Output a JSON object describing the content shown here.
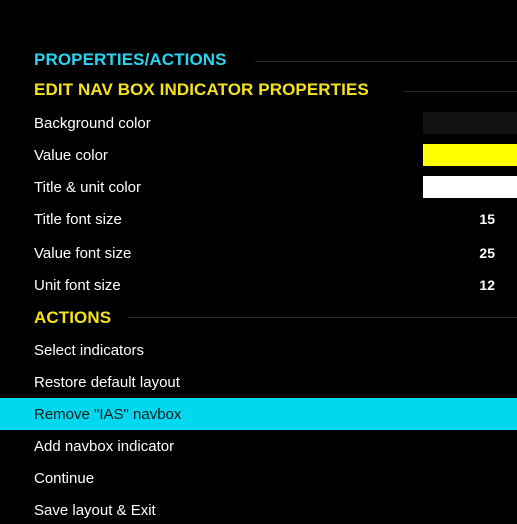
{
  "panel": {
    "header_properties": "PROPERTIES/ACTIONS",
    "header_edit": "EDIT NAV BOX INDICATOR PROPERTIES",
    "header_actions": "ACTIONS"
  },
  "properties": {
    "background_color_label": "Background color",
    "value_color_label": "Value color",
    "title_unit_color_label": "Title & unit color",
    "title_font_size_label": "Title font size",
    "title_font_size_value": "15",
    "value_font_size_label": "Value font size",
    "value_font_size_value": "25",
    "unit_font_size_label": "Unit font size",
    "unit_font_size_value": "12"
  },
  "actions": {
    "select_indicators": "Select indicators",
    "restore_default_layout": "Restore default layout",
    "remove_navbox": "Remove \"IAS\" navbox",
    "add_navbox_indicator": "Add navbox indicator",
    "continue": "Continue",
    "save_layout_exit": "Save layout & Exit"
  },
  "colors": {
    "header_cyan": "#2ad4f2",
    "header_yellow": "#f5e21b",
    "highlight": "#00d8f0",
    "background_color_swatch": "#111111",
    "value_color_swatch": "#ffff00",
    "title_unit_color_swatch": "#ffffff"
  }
}
